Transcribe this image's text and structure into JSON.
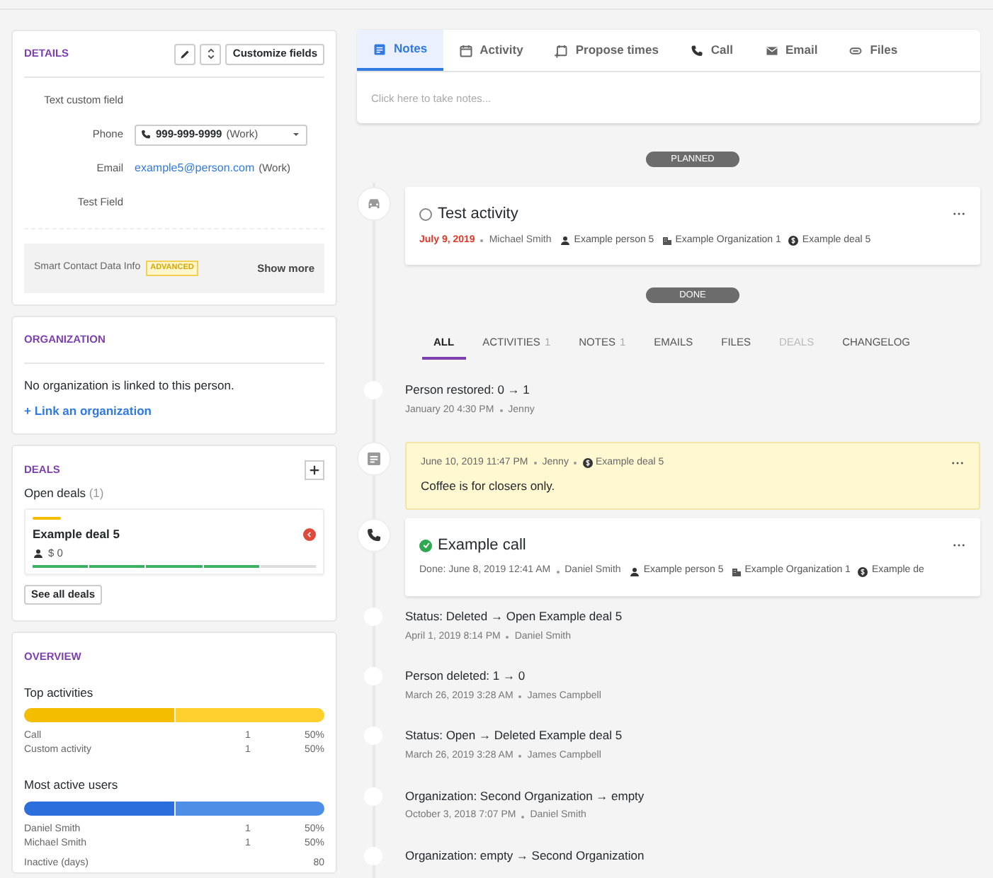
{
  "details": {
    "title": "DETAILS",
    "customize_button": "Customize fields",
    "fields": [
      {
        "label": "Text custom field",
        "kind": "text"
      },
      {
        "label": "Phone",
        "kind": "phone",
        "value": "999-999-9999",
        "note": "(Work)"
      },
      {
        "label": "Email",
        "kind": "email",
        "value": "example5@person.com",
        "note": "(Work)"
      },
      {
        "label": "Test Field",
        "kind": "text"
      }
    ],
    "smart_data": {
      "label": "Smart Contact Data Info",
      "badge": "ADVANCED",
      "action": "Show more"
    }
  },
  "organization": {
    "title": "ORGANIZATION",
    "message": "No organization is linked to this person.",
    "link": "+ Link an organization"
  },
  "deals": {
    "title": "DEALS",
    "open_label": "Open deals",
    "open_count": "(1)",
    "deal": {
      "name": "Example deal 5",
      "amount": "$ 0",
      "overdue": true,
      "stages": [
        {
          "done": true
        },
        {
          "done": true
        },
        {
          "done": true
        },
        {
          "done": true
        },
        {
          "done": false
        }
      ]
    },
    "see_all": "See all deals"
  },
  "overview": {
    "title": "OVERVIEW",
    "groups": [
      {
        "title": "Top activities",
        "rows": [
          {
            "name": "Call",
            "count": "1",
            "share": "50%",
            "level": 0.5,
            "color": "#f5bd00"
          },
          {
            "name": "Custom activity",
            "count": "1",
            "share": "50%",
            "level": 0.5,
            "color": "#ffd02e"
          }
        ]
      },
      {
        "title": "Most active users",
        "rows": [
          {
            "name": "Daniel Smith",
            "count": "1",
            "share": "50%",
            "level": 0.5,
            "color": "#2a6fdb"
          },
          {
            "name": "Michael Smith",
            "count": "1",
            "share": "50%",
            "level": 0.5,
            "color": "#4f8ee6"
          }
        ]
      }
    ],
    "inactive": {
      "label": "Inactive (days)",
      "value": "80"
    }
  },
  "composer": {
    "tabs": [
      {
        "label": "Notes",
        "kind": "note",
        "selected": true
      },
      {
        "label": "Activity",
        "kind": "calendar",
        "selected": false
      },
      {
        "label": "Propose times",
        "kind": "calendar-plus",
        "selected": false
      },
      {
        "label": "Call",
        "kind": "phone",
        "selected": false
      },
      {
        "label": "Email",
        "kind": "email",
        "selected": false
      },
      {
        "label": "Files",
        "kind": "clip",
        "selected": false
      }
    ],
    "placeholder": "Click here to take notes..."
  },
  "timeline": [
    {
      "kind": "divider",
      "label": "PLANNED"
    },
    {
      "kind": "drive",
      "title": "Test activity",
      "done": false,
      "date": "July 9, 2019",
      "overdue": true,
      "user": "Michael Smith",
      "links": [
        {
          "kind": "person",
          "text": "Example person 5"
        },
        {
          "kind": "organization",
          "text": "Example Organization 1"
        },
        {
          "kind": "deal",
          "text": "Example deal 5"
        }
      ]
    },
    {
      "kind": "divider",
      "label": "DONE"
    },
    {
      "kind": "filters",
      "items": [
        {
          "label": "ALL",
          "selected": true,
          "disabled": false
        },
        {
          "label": "ACTIVITIES",
          "count": "1",
          "selected": false,
          "disabled": false
        },
        {
          "label": "NOTES",
          "count": "1",
          "selected": false,
          "disabled": false
        },
        {
          "label": "EMAILS",
          "selected": false,
          "disabled": false
        },
        {
          "label": "FILES",
          "selected": false,
          "disabled": false
        },
        {
          "label": "DEALS",
          "selected": false,
          "disabled": true
        },
        {
          "label": "CHANGELOG",
          "selected": false,
          "disabled": false
        }
      ]
    },
    {
      "kind": "change",
      "title": "Person restored: 0 → 1",
      "date": "January 20 4:30 PM",
      "user": "Jenny"
    },
    {
      "kind": "note",
      "date": "June 10, 2019 11:47 PM",
      "user": "Jenny",
      "deal": "Example deal 5",
      "body": "Coffee is for closers only."
    },
    {
      "kind": "call",
      "title": "Example call",
      "done": true,
      "date": "Done: June 8, 2019 12:41 AM",
      "overdue": false,
      "user": "Daniel Smith",
      "links": [
        {
          "kind": "person",
          "text": "Example person 5"
        },
        {
          "kind": "organization",
          "text": "Example Organization 1"
        },
        {
          "kind": "deal",
          "text": "Example de"
        }
      ]
    },
    {
      "kind": "change",
      "title": "Status: Deleted → Open  Example deal 5",
      "date": "April 1, 2019 8:14 PM",
      "user": "Daniel Smith"
    },
    {
      "kind": "change",
      "title": "Person deleted: 1 → 0",
      "date": "March 26, 2019 3:28 AM",
      "user": "James Campbell"
    },
    {
      "kind": "change",
      "title": "Status: Open → Deleted  Example deal 5",
      "date": "March 26, 2019 3:28 AM",
      "user": "James Campbell"
    },
    {
      "kind": "change",
      "title": "Organization: Second Organization → empty",
      "date": "October 3, 2018 7:07 PM",
      "user": "Daniel Smith"
    },
    {
      "kind": "change",
      "title": "Organization: empty → Second Organization"
    }
  ]
}
